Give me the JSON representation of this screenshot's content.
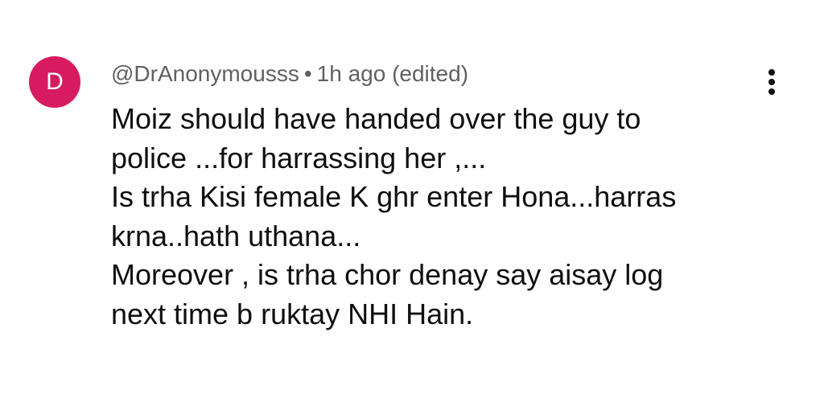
{
  "comment": {
    "avatar_letter": "D",
    "avatar_color": "#d81b60",
    "author": "@DrAnonymousss",
    "separator": "•",
    "time": "1h ago",
    "edited": "(edited)",
    "lines": [
      "Moiz should have handed over the guy to",
      "police ...for harrassing her ,...",
      "Is trha Kisi female K ghr enter Hona...harras",
      "krna..hath uthana...",
      "Moreover , is trha chor denay say aisay log",
      "next time b ruktay NHI Hain."
    ]
  },
  "menu": {
    "icon": "more-vert-icon"
  }
}
